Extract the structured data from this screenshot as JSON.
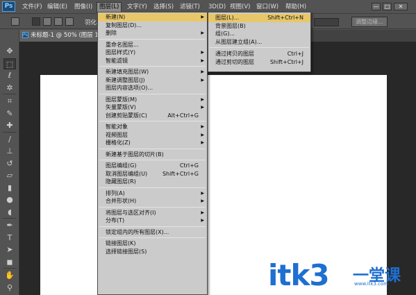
{
  "app": {
    "logo": "Ps"
  },
  "menubar": {
    "items": [
      "文件(F)",
      "编辑(E)",
      "图像(I)",
      "图层(L)",
      "文字(Y)",
      "选择(S)",
      "滤镜(T)",
      "3D(D)",
      "视图(V)",
      "窗口(W)",
      "帮助(H)"
    ],
    "active_index": 3
  },
  "window_controls": {
    "minimize": "—",
    "maximize": "□",
    "close": "✕"
  },
  "optionsbar": {
    "feather_label": "羽化",
    "refine_edge": "调整边缘..."
  },
  "document": {
    "tab_icon": "Ps",
    "tab_title": "未标题-1 @ 50% (图层 1, RGB/8) *"
  },
  "toolbar": {
    "tools": [
      {
        "name": "move-tool-icon",
        "glyph": "✥"
      },
      {
        "name": "marquee-tool-icon",
        "glyph": "⬚"
      },
      {
        "name": "lasso-tool-icon",
        "glyph": "ℓ"
      },
      {
        "name": "magic-wand-tool-icon",
        "glyph": "✲"
      },
      {
        "name": "crop-tool-icon",
        "glyph": "⌗"
      },
      {
        "name": "eyedropper-tool-icon",
        "glyph": "✎"
      },
      {
        "name": "healing-brush-tool-icon",
        "glyph": "✚"
      },
      {
        "name": "brush-tool-icon",
        "glyph": "∕"
      },
      {
        "name": "clone-stamp-tool-icon",
        "glyph": "⊥"
      },
      {
        "name": "history-brush-tool-icon",
        "glyph": "↺"
      },
      {
        "name": "eraser-tool-icon",
        "glyph": "▱"
      },
      {
        "name": "gradient-tool-icon",
        "glyph": "▮"
      },
      {
        "name": "blur-tool-icon",
        "glyph": "●"
      },
      {
        "name": "dodge-tool-icon",
        "glyph": "◖"
      },
      {
        "name": "pen-tool-icon",
        "glyph": "✒"
      },
      {
        "name": "type-tool-icon",
        "glyph": "T"
      },
      {
        "name": "path-selection-tool-icon",
        "glyph": "➤"
      },
      {
        "name": "shape-tool-icon",
        "glyph": "◼"
      },
      {
        "name": "hand-tool-icon",
        "glyph": "✋"
      },
      {
        "name": "zoom-tool-icon",
        "glyph": "⚲"
      }
    ]
  },
  "layer_menu": {
    "items": [
      {
        "label": "新建(N)",
        "submenu": true,
        "highlight": true
      },
      {
        "label": "复制图层(D)..."
      },
      {
        "label": "删除",
        "submenu": true
      },
      {
        "sep": true
      },
      {
        "label": "重命名图层..."
      },
      {
        "label": "图层样式(Y)",
        "submenu": true
      },
      {
        "label": "智能滤镜",
        "submenu": true
      },
      {
        "sep": true
      },
      {
        "label": "新建填充图层(W)",
        "submenu": true
      },
      {
        "label": "新建调整图层(J)",
        "submenu": true
      },
      {
        "label": "图层内容选项(O)..."
      },
      {
        "sep": true
      },
      {
        "label": "图层蒙版(M)",
        "submenu": true
      },
      {
        "label": "矢量蒙版(V)",
        "submenu": true
      },
      {
        "label": "创建剪贴蒙版(C)",
        "shortcut": "Alt+Ctrl+G"
      },
      {
        "sep": true
      },
      {
        "label": "智能对象",
        "submenu": true
      },
      {
        "label": "视频图层",
        "submenu": true
      },
      {
        "label": "栅格化(Z)",
        "submenu": true
      },
      {
        "sep": true
      },
      {
        "label": "新建基于图层的切片(B)"
      },
      {
        "sep": true
      },
      {
        "label": "图层编组(G)",
        "shortcut": "Ctrl+G"
      },
      {
        "label": "取消图层编组(U)",
        "shortcut": "Shift+Ctrl+G"
      },
      {
        "label": "隐藏图层(R)"
      },
      {
        "sep": true
      },
      {
        "label": "排列(A)",
        "submenu": true
      },
      {
        "label": "合并形状(H)",
        "submenu": true
      },
      {
        "sep": true
      },
      {
        "label": "将图层与选区对齐(I)",
        "submenu": true
      },
      {
        "label": "分布(T)",
        "submenu": true
      },
      {
        "sep": true
      },
      {
        "label": "锁定组内的所有图层(X)..."
      },
      {
        "sep": true
      },
      {
        "label": "链接图层(K)"
      },
      {
        "label": "选择链接图层(S)"
      }
    ]
  },
  "new_submenu": {
    "items": [
      {
        "label": "图层(L)...",
        "shortcut": "Shift+Ctrl+N",
        "highlight": true
      },
      {
        "label": "背景图层(B)"
      },
      {
        "label": "组(G)..."
      },
      {
        "label": "从图层建立组(A)..."
      },
      {
        "sep": true
      },
      {
        "label": "通过拷贝的图层",
        "shortcut": "Ctrl+J"
      },
      {
        "label": "通过剪切的图层",
        "shortcut": "Shift+Ctrl+J"
      }
    ]
  },
  "watermark": {
    "text": "itk3",
    "cn": "一堂课",
    "url": "www.itk3.com"
  },
  "colors": {
    "menu_highlight": "#e8c76a",
    "menu_bg": "#cbcbcb",
    "ui_bg": "#535353",
    "workspace": "#282828",
    "watermark": "#1e6fd0"
  }
}
